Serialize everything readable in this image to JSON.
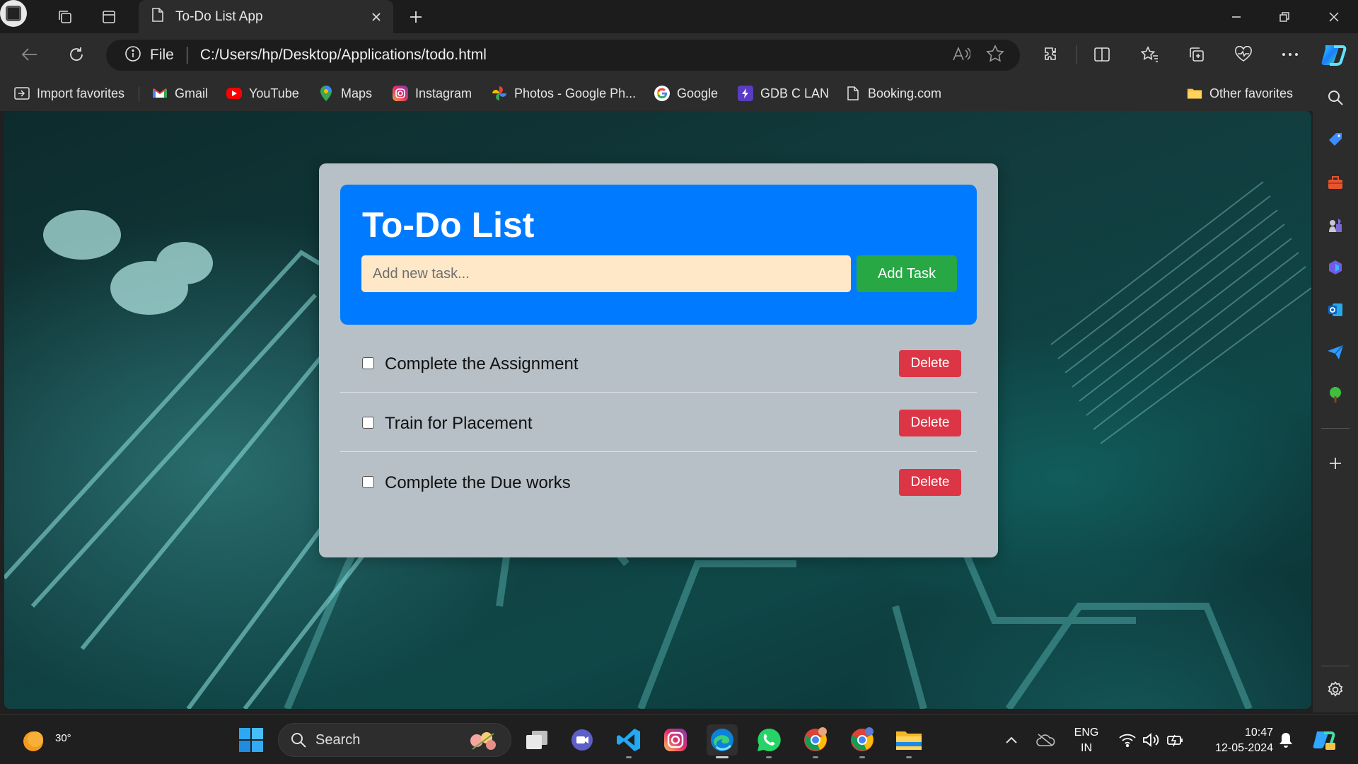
{
  "browser": {
    "tab_title": "To-Do List App",
    "address": {
      "scheme_label": "File",
      "url": "C:/Users/hp/Desktop/Applications/todo.html"
    },
    "favorites": [
      {
        "label": "Import favorites",
        "icon": "import-icon"
      },
      {
        "label": "Gmail",
        "icon": "gmail-icon"
      },
      {
        "label": "YouTube",
        "icon": "youtube-icon"
      },
      {
        "label": "Maps",
        "icon": "maps-icon"
      },
      {
        "label": "Instagram",
        "icon": "instagram-icon"
      },
      {
        "label": "Photos - Google Ph...",
        "icon": "photos-icon"
      },
      {
        "label": "Google",
        "icon": "google-icon"
      },
      {
        "label": "GDB C LAN",
        "icon": "gdb-icon"
      },
      {
        "label": "Booking.com",
        "icon": "page-icon"
      }
    ],
    "other_favorites": "Other favorites"
  },
  "todo": {
    "title": "To-Do List",
    "input_placeholder": "Add new task...",
    "add_button": "Add Task",
    "delete_label": "Delete",
    "tasks": [
      {
        "text": "Complete the Assignment",
        "done": false
      },
      {
        "text": "Train for Placement",
        "done": false
      },
      {
        "text": "Complete the Due works",
        "done": false
      }
    ],
    "colors": {
      "header": "#007bff",
      "card": "#b7c0c7",
      "add_button": "#28a745",
      "delete_button": "#dc3545",
      "input_bg": "#ffe8c8"
    }
  },
  "taskbar": {
    "weather_temp": "30°",
    "search_label": "Search",
    "lang_line1": "ENG",
    "lang_line2": "IN",
    "time": "10:47",
    "date": "12-05-2024"
  }
}
